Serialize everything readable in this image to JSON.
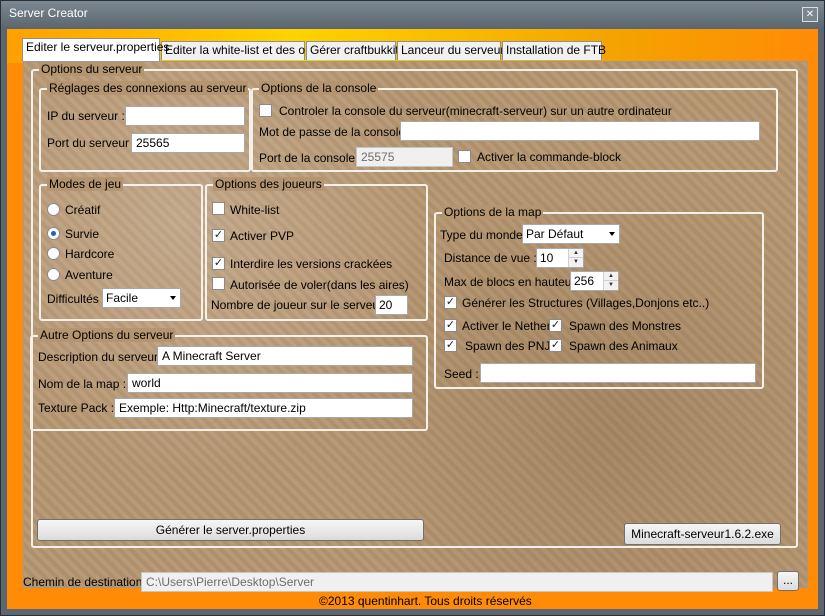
{
  "window": {
    "title": "Server Creator",
    "close_glyph": "✕"
  },
  "tabs": [
    {
      "label": "Editer le serveur.properties",
      "active": true
    },
    {
      "label": "Editer la white-list et des ops"
    },
    {
      "label": "Gérer craftbukkit"
    },
    {
      "label": "Lanceur du serveur"
    },
    {
      "label": "Installation de FTB"
    }
  ],
  "options_serveur": {
    "legend": "Options du serveur",
    "connexions": {
      "legend": "Réglages des connexions au serveur",
      "ip_label": "IP du serveur :",
      "ip_value": "",
      "port_label": "Port du serveur :",
      "port_value": "25565"
    },
    "console": {
      "legend": "Options de la console",
      "remote_label": "Controler la console du serveur(minecraft-serveur) sur un autre ordinateur",
      "remote_checked": false,
      "password_label": "Mot de passe de la console :",
      "password_value": "",
      "port_label": "Port de la console :",
      "port_value": "25575",
      "command_block_label": "Activer la commande-block",
      "command_block_checked": false
    },
    "modes": {
      "legend": "Modes de jeu",
      "options": [
        "Créatif",
        "Survie",
        "Hardcore",
        "Aventure"
      ],
      "selected": "Survie",
      "difficulty_label": "Difficultés :",
      "difficulty_value": "Facile"
    },
    "joueurs": {
      "legend": "Options des joueurs",
      "whitelist_label": "White-list",
      "whitelist_checked": false,
      "pvp_label": "Activer PVP",
      "pvp_checked": true,
      "cracked_label": "Interdire les versions crackées",
      "cracked_checked": true,
      "fly_label": "Autorisée de voler(dans les aires)",
      "fly_checked": false,
      "max_players_label": "Nombre de joueur sur le serveur :",
      "max_players_value": "20"
    },
    "map": {
      "legend": "Options de la map",
      "world_type_label": "Type du monde :",
      "world_type_value": "Par Défaut",
      "view_distance_label": "Distance de vue :",
      "view_distance_value": "10",
      "max_height_label": "Max de blocs en hauteur :",
      "max_height_value": "256",
      "structures_label": "Générer les Structures (Villages,Donjons etc..)",
      "structures_checked": true,
      "nether_label": "Activer le Nether",
      "nether_checked": true,
      "monsters_label": "Spawn des Monstres",
      "monsters_checked": true,
      "npc_label": "Spawn des PNJ",
      "npc_checked": true,
      "animals_label": "Spawn des Animaux",
      "animals_checked": true,
      "seed_label": "Seed :",
      "seed_value": ""
    },
    "autres": {
      "legend": "Autre Options du serveur",
      "description_label": "Description du serveur :",
      "description_value": "A Minecraft Server",
      "map_name_label": "Nom de la map :",
      "map_name_value": "world",
      "texture_label": "Texture Pack :",
      "texture_value": "Exemple: Http:Minecraft/texture.zip"
    },
    "generate_button": "Générer le server.properties",
    "exe_button": "Minecraft-serveur1.6.2.exe"
  },
  "footer": {
    "destination_label": "Chemin de destination :",
    "destination_value": "C:\\Users\\Pierre\\Desktop\\Server",
    "browse_label": "...",
    "copyright": "©2013 quentinhart. Tous droits réservés"
  },
  "check_glyph": "✓"
}
